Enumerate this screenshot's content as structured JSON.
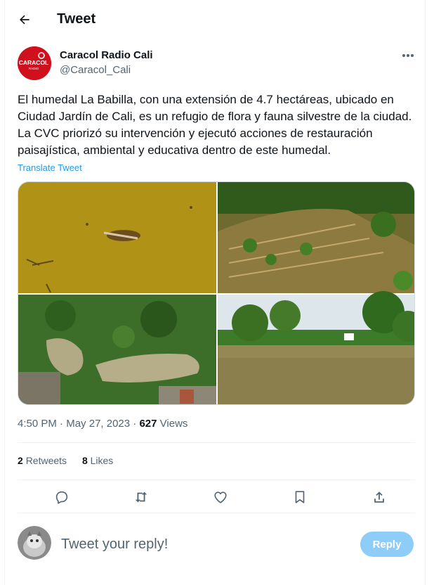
{
  "header": {
    "title": "Tweet"
  },
  "tweet": {
    "author_name": "Caracol Radio Cali",
    "author_handle": "@Caracol_Cali",
    "logo_text": "CARACOL",
    "logo_subtext": "RADIO",
    "text": "El humedal La Babilla, con una extensión de 4.7 hectáreas, ubicado en Ciudad Jardín de Cali, es un refugio de flora y fauna silvestre de la ciudad. La CVC priorizó su intervención y ejecutó acciones de restauración paisajística, ambiental y educativa dentro de este humedal.",
    "translate_label": "Translate Tweet",
    "time": "4:50 PM",
    "date": "May 27, 2023",
    "views_count": "627",
    "views_label": "Views",
    "retweets_count": "2",
    "retweets_label": "Retweets",
    "likes_count": "8",
    "likes_label": "Likes"
  },
  "actions": [
    "reply-icon",
    "retweet-icon",
    "like-icon",
    "bookmark-icon",
    "share-icon"
  ],
  "reply": {
    "placeholder": "Tweet your reply!",
    "button_label": "Reply"
  },
  "colors": {
    "accent": "#1d9bf0",
    "reply_button": "#8ecdf8",
    "brand_logo": "#d0101c"
  }
}
